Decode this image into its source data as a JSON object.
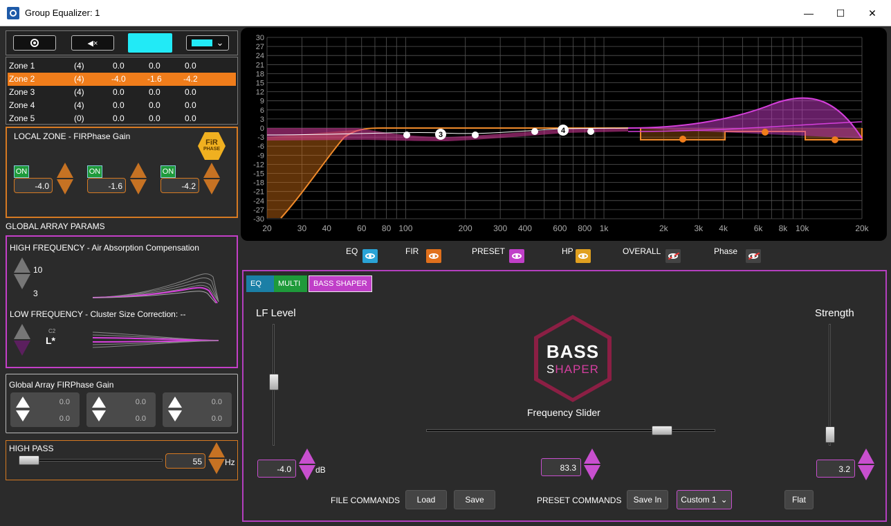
{
  "window": {
    "title": "Group Equalizer: 1",
    "minimize": "—",
    "maximize": "☐",
    "close": "✕"
  },
  "colors": {
    "accent_orange": "#f07d1b",
    "accent_pink": "#c84fcf",
    "accent_cyan": "#22eaf6",
    "on_green": "#1e9a3a"
  },
  "topbar": {
    "dropdown_arrow": "⌄"
  },
  "zones": [
    {
      "name": "Zone 1",
      "count": "(4)",
      "v1": "0.0",
      "v2": "0.0",
      "v3": "0.0"
    },
    {
      "name": "Zone 2",
      "count": "(4)",
      "v1": "-4.0",
      "v2": "-1.6",
      "v3": "-4.2"
    },
    {
      "name": "Zone 3",
      "count": "(4)",
      "v1": "0.0",
      "v2": "0.0",
      "v3": "0.0"
    },
    {
      "name": "Zone 4",
      "count": "(4)",
      "v1": "0.0",
      "v2": "0.0",
      "v3": "0.0"
    },
    {
      "name": "Zone 5",
      "count": "(0)",
      "v1": "0.0",
      "v2": "0.0",
      "v3": "0.0"
    }
  ],
  "local_zone": {
    "label": "LOCAL ZONE - FIRPhase Gain",
    "badge_top": "FiR",
    "badge_bottom": "PHASE",
    "on": "ON",
    "gains": [
      "-4.0",
      "-1.6",
      "-4.2"
    ]
  },
  "global_array": {
    "label": "GLOBAL ARRAY PARAMS",
    "hf_label": "HIGH FREQUENCY - Air Absorption Compensation",
    "hf_top": "10",
    "hf_bottom": "3",
    "lf_label": "LOW FREQUENCY - Cluster Size Correction: --",
    "lf_sub": "C2",
    "lf_value": "L*"
  },
  "global_firphase": {
    "label": "Global Array FIRPhase Gain",
    "boxes": [
      {
        "top": "0.0",
        "bottom": "0.0"
      },
      {
        "top": "0.0",
        "bottom": "0.0"
      },
      {
        "top": "0.0",
        "bottom": "0.0"
      }
    ]
  },
  "high_pass": {
    "label": "HIGH PASS",
    "value": "55",
    "unit": "Hz"
  },
  "graph": {
    "y_ticks": [
      "30",
      "27",
      "24",
      "21",
      "18",
      "15",
      "12",
      "9",
      "6",
      "3",
      "0",
      "-3",
      "-6",
      "-9",
      "-12",
      "-15",
      "-18",
      "-21",
      "-24",
      "-27",
      "-30"
    ],
    "x_ticks": [
      "20",
      "30",
      "40",
      "60",
      "80",
      "100",
      "200",
      "300",
      "400",
      "600",
      "800",
      "1k",
      "2k",
      "3k",
      "4k",
      "6k",
      "8k",
      "10k",
      "20k"
    ],
    "markers": [
      "3",
      "4"
    ]
  },
  "legend": [
    "EQ",
    "FIR",
    "PRESET",
    "HP",
    "OVERALL",
    "Phase"
  ],
  "tabs": {
    "eq": "EQ",
    "multi": "MULTI",
    "bass_shaper": "BASS SHAPER"
  },
  "shaper": {
    "lf_level_label": "LF Level",
    "lf_level_value": "-4.0",
    "lf_unit": "dB",
    "strength_label": "Strength",
    "strength_value": "3.2",
    "freq_label": "Frequency Slider",
    "freq_value": "83.3",
    "logo_top": "BASS",
    "logo_s": "S",
    "logo_h": "H",
    "logo_rest": "APER"
  },
  "commands": {
    "file_label": "FILE COMMANDS",
    "load": "Load",
    "save": "Save",
    "preset_label": "PRESET COMMANDS",
    "save_in": "Save In",
    "preset_select": "Custom 1",
    "flat": "Flat"
  }
}
